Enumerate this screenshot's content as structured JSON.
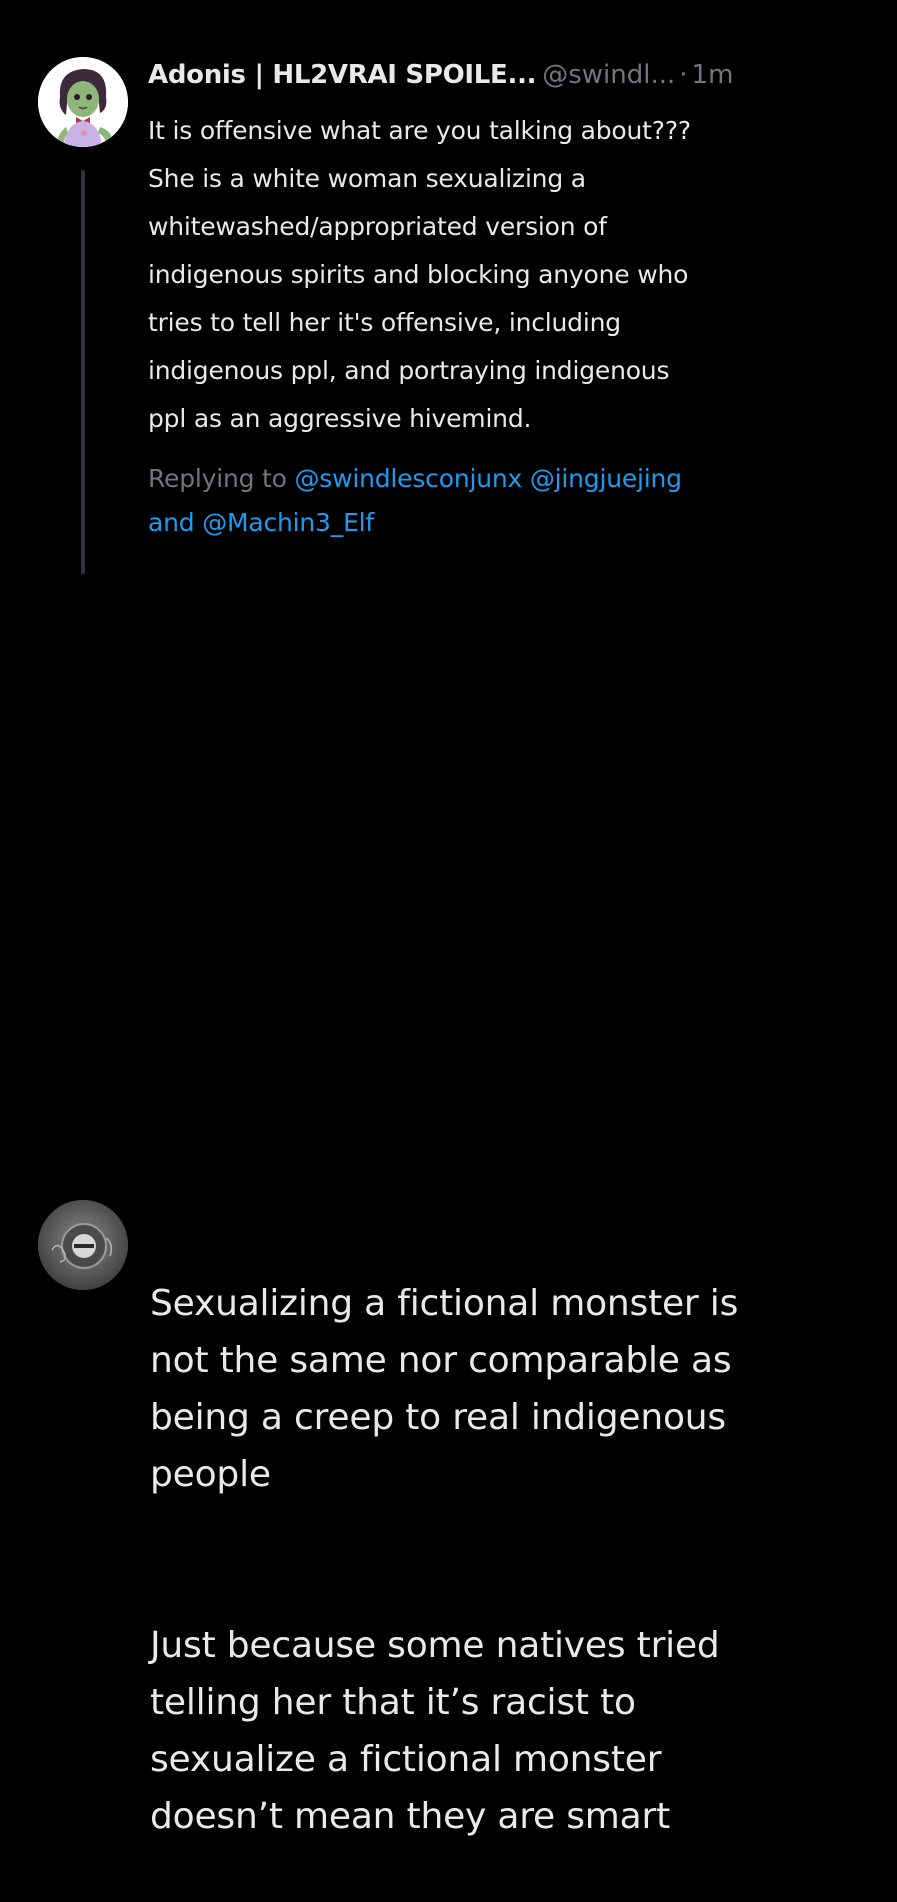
{
  "tweet_1": {
    "display_name": "Adonis | HL2VRAI SPOILE...",
    "handle": "@swindl...",
    "separator": "·",
    "time": "1m",
    "text": "It is offensive what are you talking about???\nShe is a white woman sexualizing a\nwhitewashed/appropriated version of\nindigenous spirits and blocking anyone who\ntries to tell her it's offensive, including\nindigenous ppl, and portraying indigenous\nppl as an aggressive hivemind.",
    "replying_prefix": "Replying to",
    "mentions": [
      "@swindlesconjunx",
      "@jingjuejing",
      "@Machin3_Elf"
    ],
    "and_word": "and"
  },
  "tweet_2": {
    "paragraphs": [
      "Sexualizing a fictional monster is\nnot the same nor comparable as\nbeing a creep to real indigenous\npeople",
      "Just because some natives tried\ntelling her that it’s racist to\nsexualize a fictional monster\ndoesn’t mean they are smart"
    ]
  },
  "colors": {
    "background": "#000000",
    "text_primary": "#e7e9ea",
    "text_secondary": "#71767b",
    "link": "#1d9bf0",
    "thread_line": "#333639"
  },
  "icons": {
    "avatar_1": "cartoon-character-avatar",
    "avatar_2": "dark-gray-avatar"
  }
}
